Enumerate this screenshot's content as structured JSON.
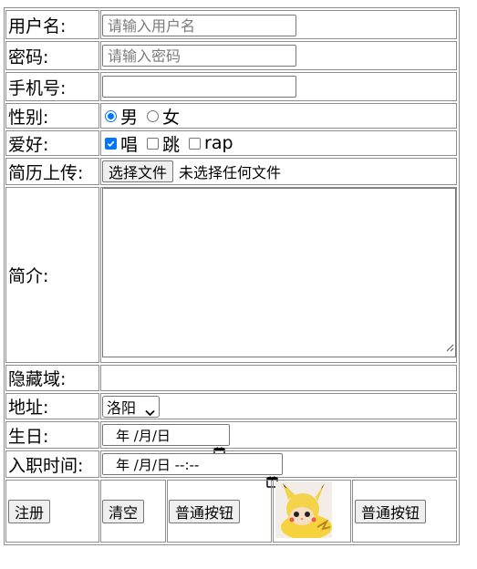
{
  "form": {
    "username": {
      "label": "用户名:",
      "placeholder": "请输入用户名",
      "value": ""
    },
    "password": {
      "label": "密码:",
      "placeholder": "请输入密码",
      "value": ""
    },
    "phone": {
      "label": "手机号:",
      "value": ""
    },
    "gender": {
      "label": "性别:",
      "options": [
        "男",
        "女"
      ],
      "selected": "男"
    },
    "hobby": {
      "label": "爱好:",
      "options": [
        "唱",
        "跳",
        "rap"
      ],
      "checked": [
        "唱"
      ]
    },
    "resume": {
      "label": "简历上传:",
      "button_label": "选择文件",
      "status": "未选择任何文件"
    },
    "intro": {
      "label": "简介:",
      "value": ""
    },
    "hidden": {
      "label": "隐藏域:"
    },
    "address": {
      "label": "地址:",
      "selected": "洛阳"
    },
    "birthday": {
      "label": "生日:",
      "display": "年 /月/日"
    },
    "hire_time": {
      "label": "入职时间:",
      "display": "年 /月/日 --:--"
    }
  },
  "actions": {
    "register_label": "注册",
    "clear_label": "清空",
    "normal_button_1_label": "普通按钮",
    "normal_button_2_label": "普通按钮",
    "image_button_icon": "cat-pikachu-costume-image"
  },
  "colors": {
    "accent": "#0075ff",
    "border": "#8e8e8e",
    "button_bg": "#efefef"
  }
}
